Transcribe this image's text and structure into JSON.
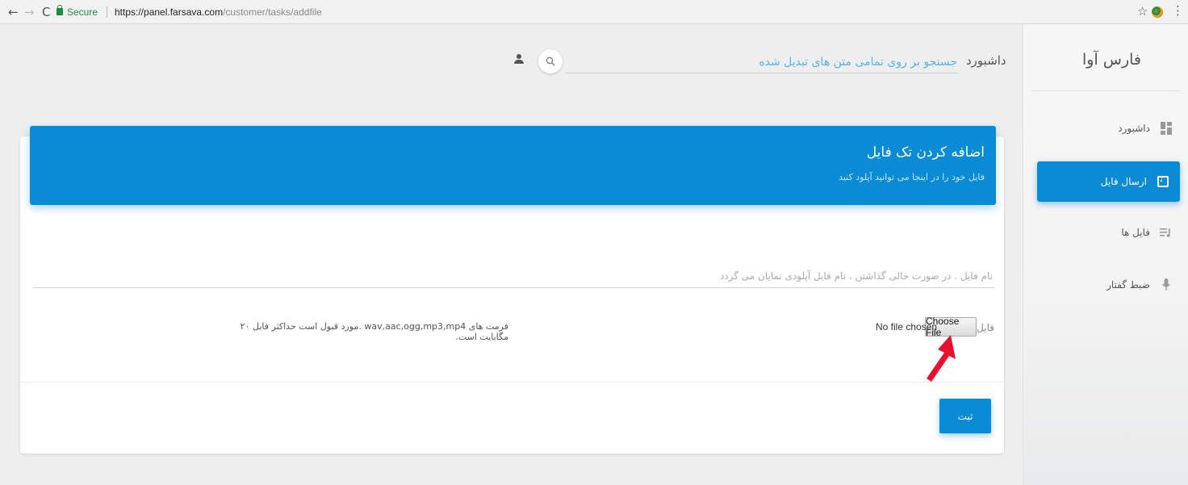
{
  "browser": {
    "secure_label": "Secure",
    "url_host": "https://panel.farsava.com",
    "url_path": "/customer/tasks/addfile"
  },
  "sidebar": {
    "brand": "فارس آوا",
    "items": [
      {
        "label": "داشبورد",
        "icon": "dashboard-icon",
        "active": false
      },
      {
        "label": "ارسال فایل",
        "icon": "music-note-icon",
        "active": true
      },
      {
        "label": "فایل ها",
        "icon": "playlist-icon",
        "active": false
      },
      {
        "label": "ضبط گفتار",
        "icon": "microphone-icon",
        "active": false
      }
    ]
  },
  "topbar": {
    "title": "داشبورد",
    "search_placeholder": "جستجو بر روی تمامی متن های تبدیل شده"
  },
  "card": {
    "title": "اضافه کردن تک فایل",
    "subtitle": "فایل خود را در اینجا می توانید آپلود کنید",
    "filename_placeholder": "نام فایل . در صورت خالی گذاشتن ، نام فایل آپلودی نمایان می گردد",
    "file_label": "فایل",
    "choose_button": "Choose File",
    "no_file": "No file chosen",
    "format_note": "فرمت های wav,aac,ogg,mp3,mp4 .مورد قبول است حداکثر فایل ۲۰ مگابایت است.",
    "submit_label": "ثبت"
  },
  "colors": {
    "accent": "#0a8bd6",
    "annotation_arrow": "#e8102e"
  }
}
